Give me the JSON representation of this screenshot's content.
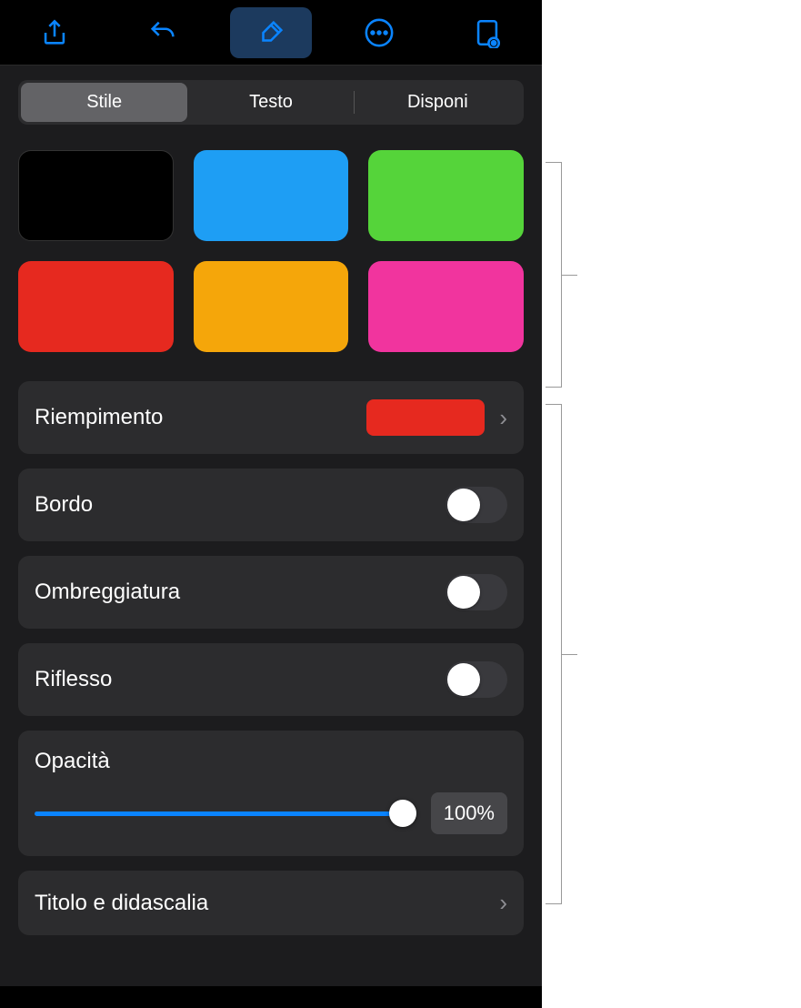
{
  "toolbar": {
    "items": [
      "share",
      "undo",
      "format",
      "more",
      "document"
    ]
  },
  "tabs": {
    "items": [
      "Stile",
      "Testo",
      "Disponi"
    ],
    "selected": 0
  },
  "swatches": [
    {
      "color": "#000000",
      "name": "black"
    },
    {
      "color": "#1e9ef4",
      "name": "blue"
    },
    {
      "color": "#55d43a",
      "name": "green"
    },
    {
      "color": "#e6291f",
      "name": "red"
    },
    {
      "color": "#f5a60a",
      "name": "orange"
    },
    {
      "color": "#f1349e",
      "name": "pink"
    }
  ],
  "fill": {
    "label": "Riempimento",
    "color": "#e6291f"
  },
  "border": {
    "label": "Bordo",
    "on": false
  },
  "shadow": {
    "label": "Ombreggiatura",
    "on": false
  },
  "reflection": {
    "label": "Riflesso",
    "on": false
  },
  "opacity": {
    "label": "Opacità",
    "value": 100,
    "display": "100%"
  },
  "titleCaption": {
    "label": "Titolo e didascalia"
  }
}
